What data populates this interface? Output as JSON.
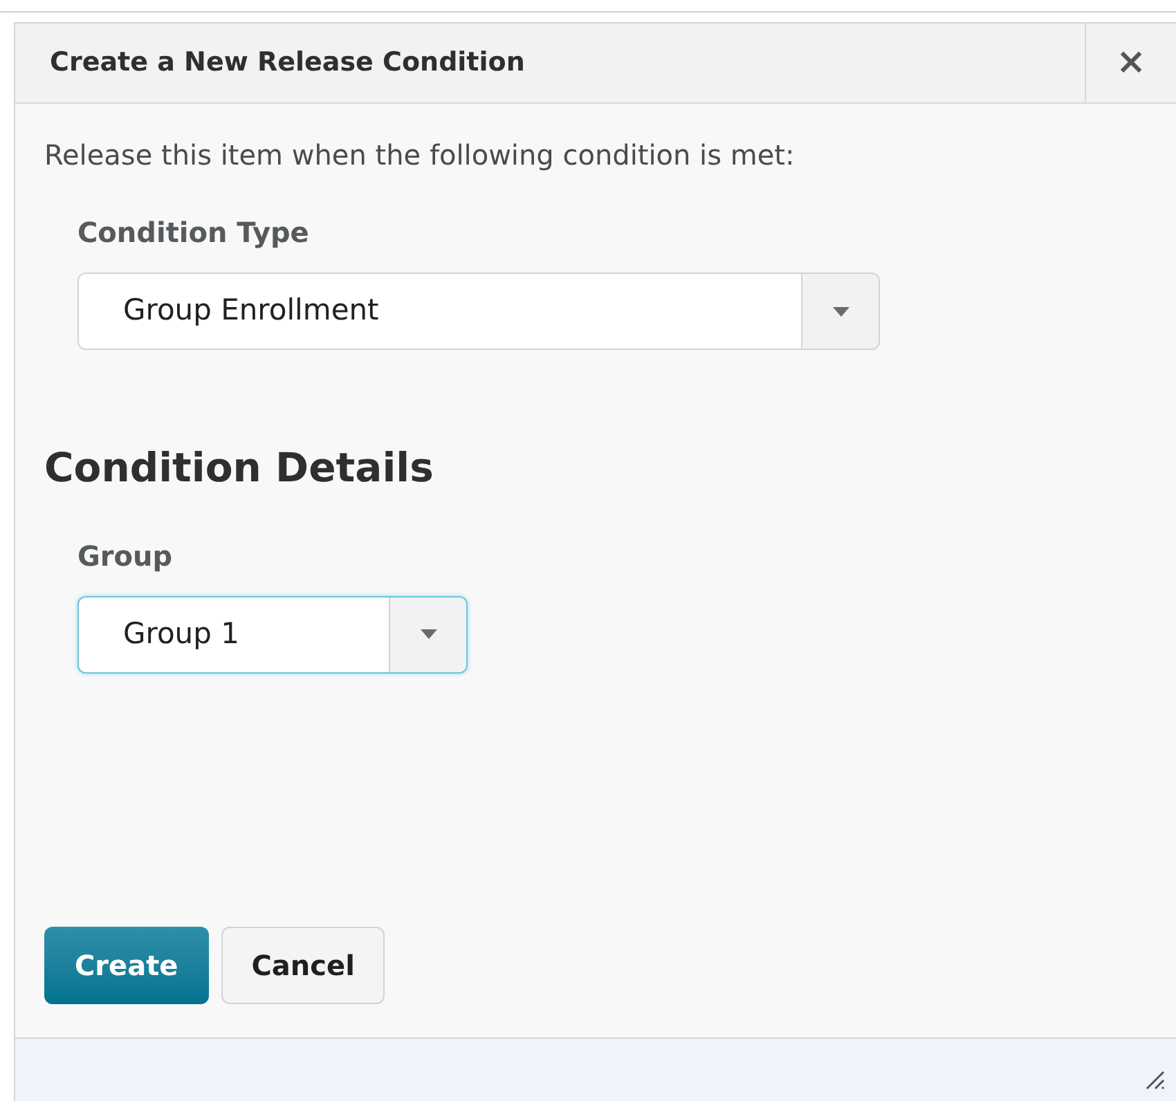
{
  "dialog": {
    "title": "Create a New Release Condition",
    "close": "×"
  },
  "intro": "Release this item when the following condition is met:",
  "condition_type": {
    "label": "Condition Type",
    "value": "Group Enrollment",
    "focused": false
  },
  "details": {
    "heading": "Condition Details",
    "field": {
      "label": "Group",
      "value": "Group 1",
      "focused": true
    }
  },
  "buttons": [
    {
      "label": "Create",
      "kind": "primary"
    },
    {
      "label": "Cancel",
      "kind": "secondary"
    }
  ]
}
